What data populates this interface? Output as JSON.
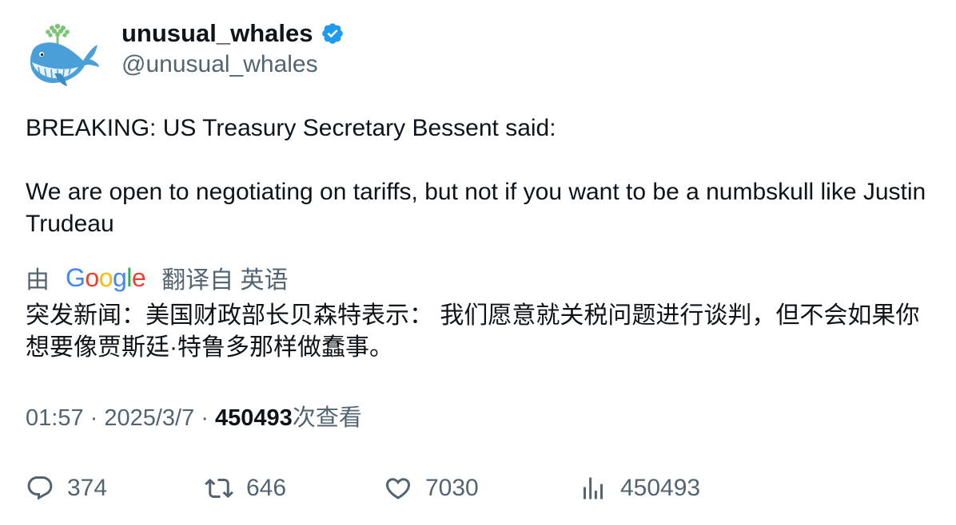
{
  "author": {
    "display_name": "unusual_whales",
    "handle": "@unusual_whales",
    "verified": true,
    "avatar": "whale-logo-icon"
  },
  "tweet": {
    "lines": [
      "BREAKING: US Treasury Secretary Bessent said:",
      "We are open to negotiating on tariffs, but not if you want to be a numbskull like Justin Trudeau"
    ]
  },
  "translation": {
    "prefix": "由",
    "provider": "Google",
    "suffix": "翻译自 英语",
    "text": "突发新闻：美国财政部长贝森特表示： 我们愿意就关税问题进行谈判，但不会如果你想要像贾斯廷·特鲁多那样做蠢事。"
  },
  "meta": {
    "time": "01:57",
    "separator": "·",
    "date": "2025/3/7",
    "views_count": "450493",
    "views_label": "次查看"
  },
  "actions": {
    "replies": "374",
    "retweets": "646",
    "likes": "7030",
    "views": "450493"
  },
  "colors": {
    "verified": "#1d9bf0",
    "secondary_text": "#536471",
    "primary_text": "#0f1419",
    "whale_body": "#4a9fd8",
    "spout": "#7cc576"
  }
}
